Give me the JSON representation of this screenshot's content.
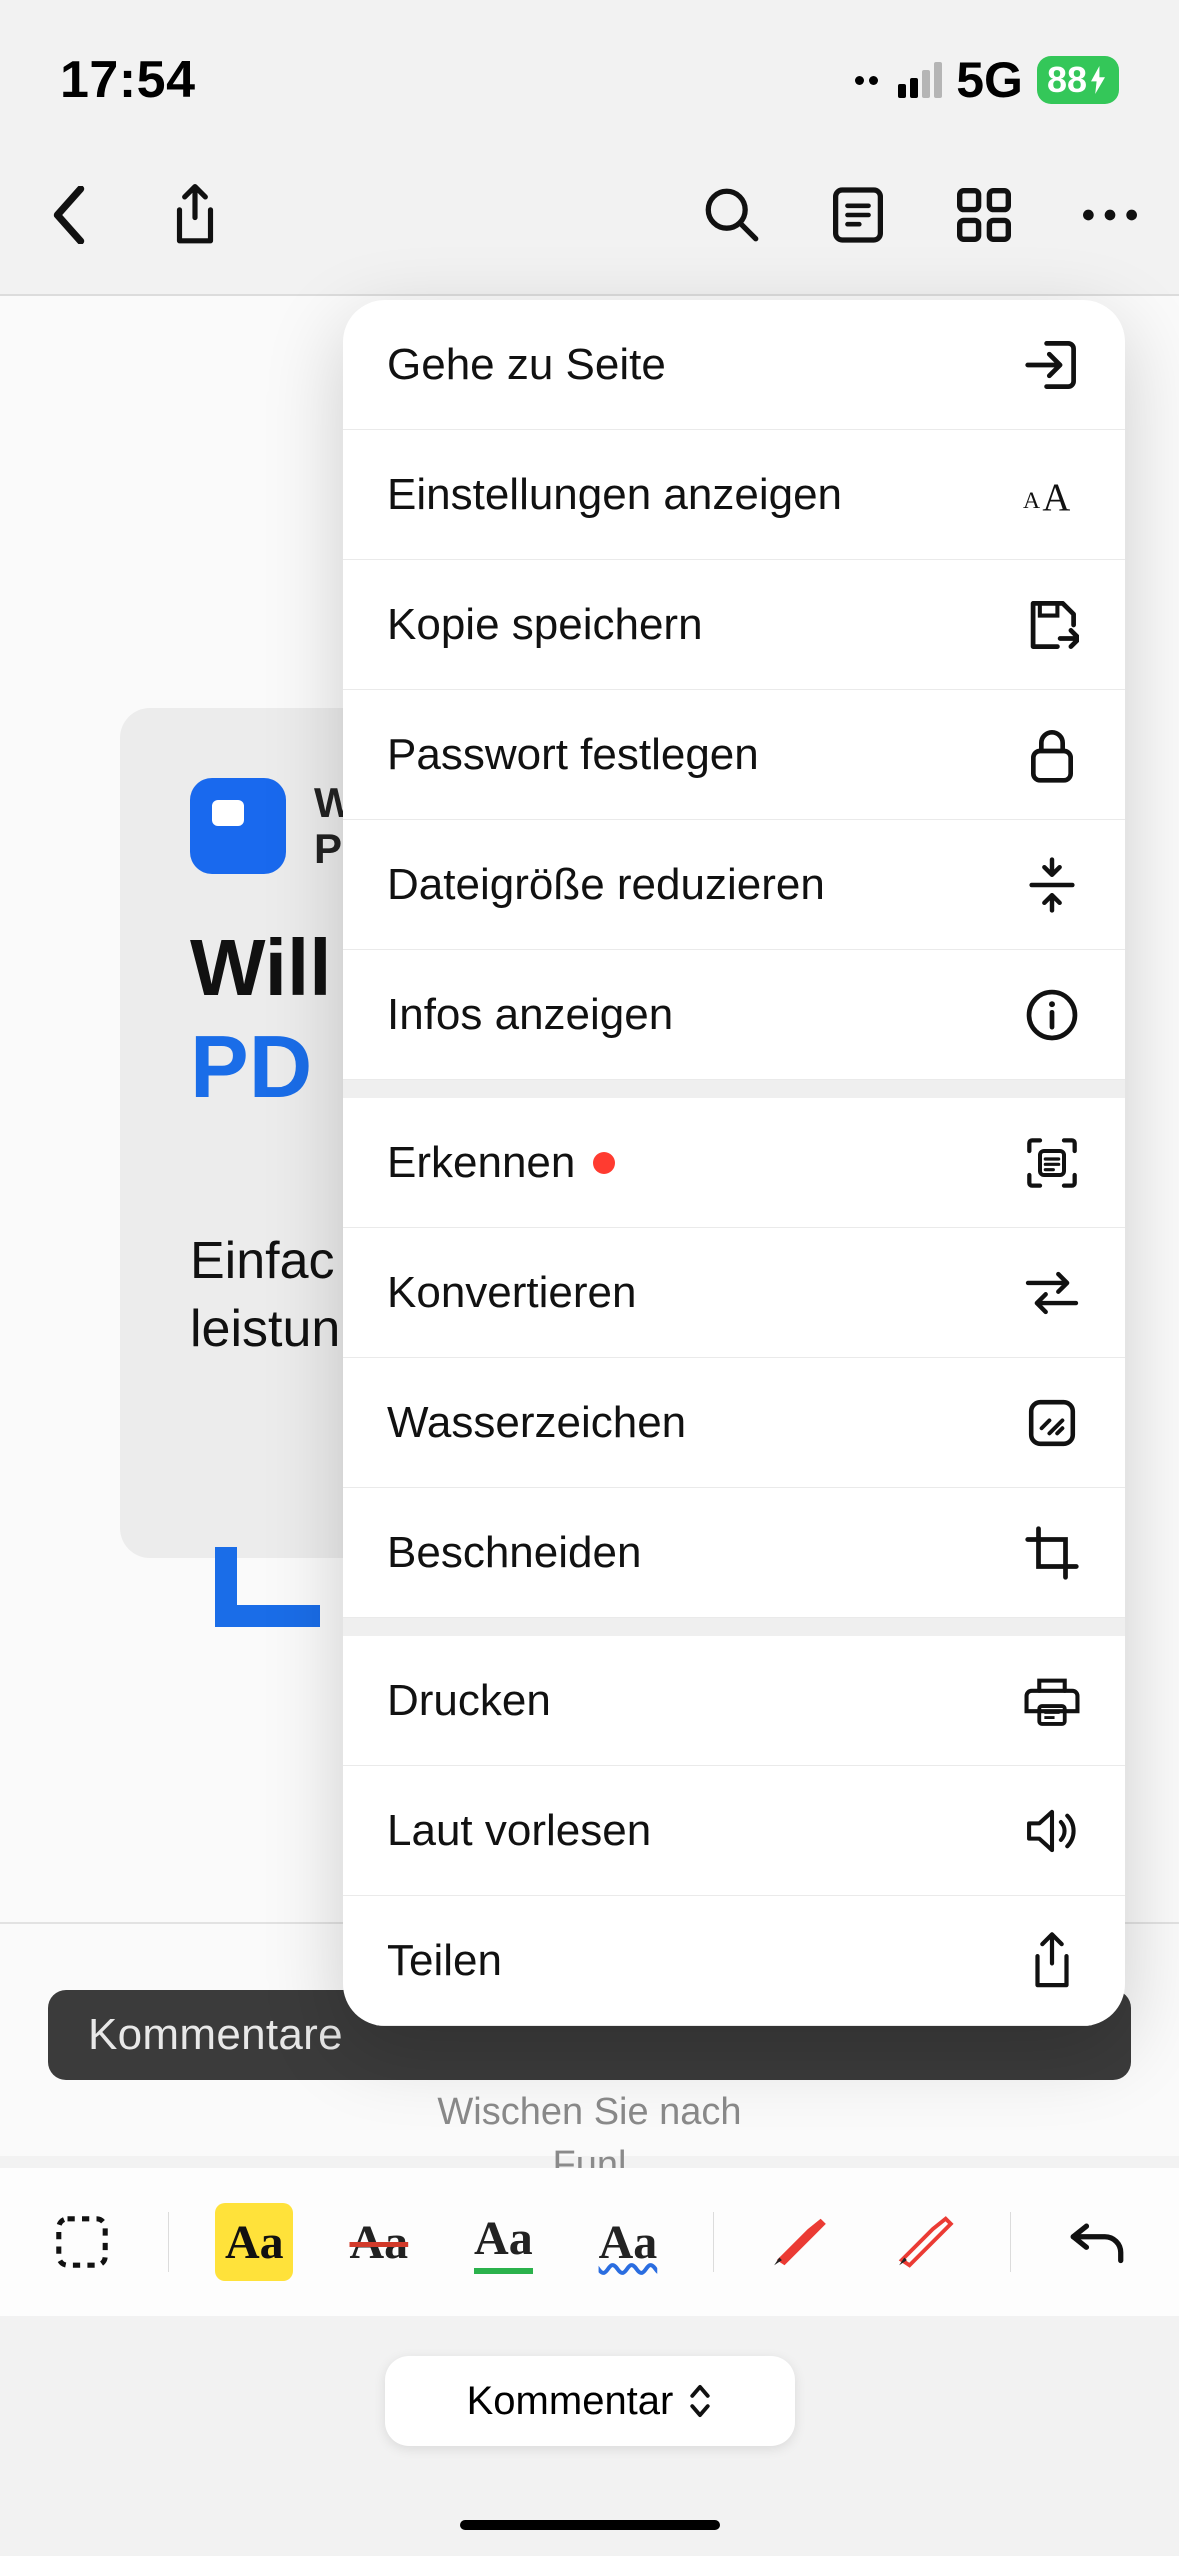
{
  "status": {
    "time": "17:54",
    "net": "5G",
    "battery": "88"
  },
  "document": {
    "brand_top": "W",
    "brand_bottom": "PI",
    "title_line1": "Will",
    "title_line2": "PD",
    "sub_line1": "Einfac",
    "sub_line2": "leistun"
  },
  "hint": {
    "line1": "Wischen Sie nach",
    "line2": "Funl"
  },
  "banner": {
    "text": "Kommentare"
  },
  "mode": {
    "label": "Kommentar"
  },
  "menu": {
    "s1": [
      {
        "label": "Gehe zu Seite",
        "icon": "goto"
      },
      {
        "label": "Einstellungen anzeigen",
        "icon": "textsize"
      },
      {
        "label": "Kopie speichern",
        "icon": "savecopy"
      },
      {
        "label": "Passwort festlegen",
        "icon": "lock"
      },
      {
        "label": "Dateigröße reduzieren",
        "icon": "compress"
      },
      {
        "label": "Infos anzeigen",
        "icon": "info"
      }
    ],
    "s2": [
      {
        "label": "Erkennen",
        "icon": "ocr",
        "dot": true
      },
      {
        "label": "Konvertieren",
        "icon": "convert"
      },
      {
        "label": "Wasserzeichen",
        "icon": "watermark"
      },
      {
        "label": "Beschneiden",
        "icon": "crop"
      }
    ],
    "s3": [
      {
        "label": "Drucken",
        "icon": "print"
      },
      {
        "label": "Laut vorlesen",
        "icon": "speaker"
      },
      {
        "label": "Teilen",
        "icon": "share"
      }
    ]
  }
}
